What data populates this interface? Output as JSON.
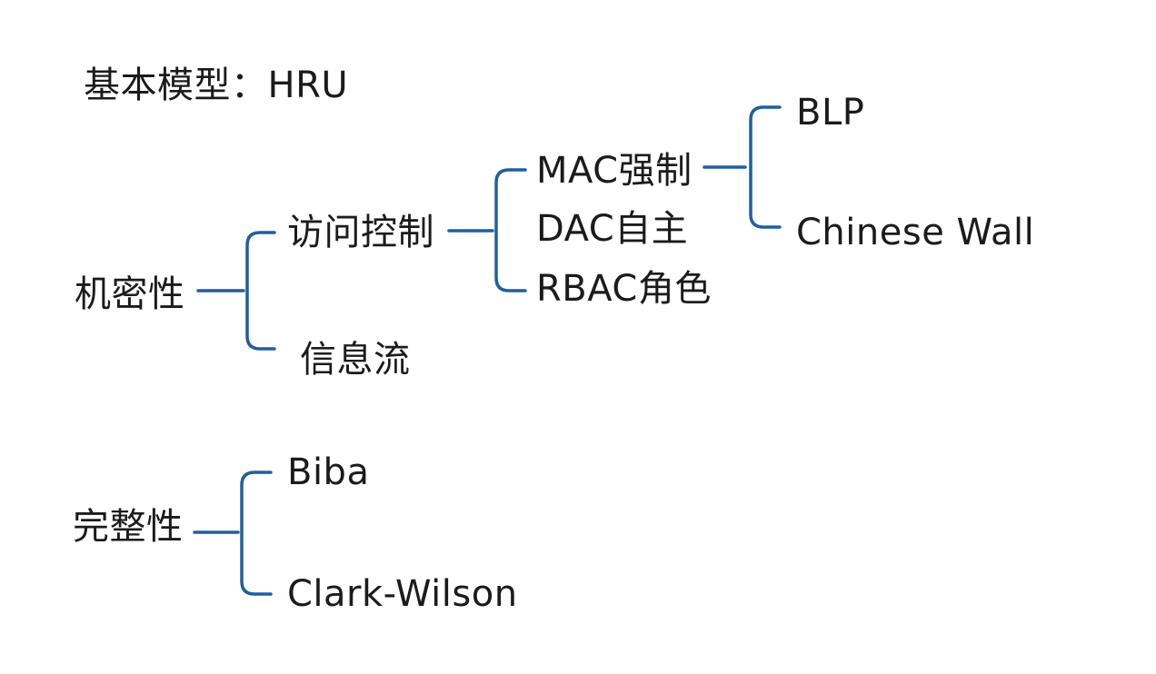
{
  "colors": {
    "connector": "#1f5fa0",
    "text": "#1b1b1b",
    "background": "#ffffff"
  },
  "header": {
    "text": "基本模型：HRU"
  },
  "confidentiality": {
    "label": "机密性",
    "access_control": {
      "label": "访问控制",
      "mac": {
        "label": "MAC强制",
        "children": [
          "BLP",
          "Chinese Wall"
        ]
      },
      "dac": {
        "label": "DAC自主"
      },
      "rbac": {
        "label": "RBAC角色"
      }
    },
    "information_flow": {
      "label": "信息流"
    }
  },
  "integrity": {
    "label": "完整性",
    "children": [
      "Biba",
      "Clark-Wilson"
    ]
  }
}
